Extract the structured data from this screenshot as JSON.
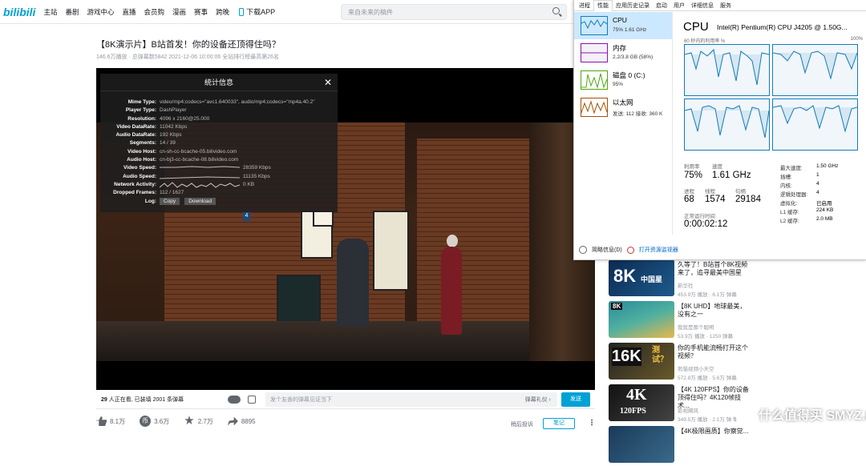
{
  "site": {
    "logo": "bilibili",
    "accent": "#00a1d6"
  },
  "nav": [
    "主站",
    "番剧",
    "游戏中心",
    "直播",
    "会员购",
    "漫画",
    "赛事",
    "跨晚"
  ],
  "download_app": "下载APP",
  "search": {
    "placeholder": "来自未来的稿件"
  },
  "video": {
    "title": "【8K演示片】B站首发！你的设备还顶得住吗？",
    "meta": "146.6万播放 · 总弹幕数5842    2021-12-06 10:00:06  全站排行榜最高第26名"
  },
  "stats": {
    "title": "统计信息",
    "close": "✕",
    "rows": [
      {
        "k": "Mime Type:",
        "v": "video/mp4;codecs=\"avc1.640033\", audio/mp4;codecs=\"mp4a.40.2\""
      },
      {
        "k": "Player Type:",
        "v": "DashPlayer"
      },
      {
        "k": "Resolution:",
        "v": "4096 x 2160@25.000"
      },
      {
        "k": "Video DataRate:",
        "v": "11042 Kbps"
      },
      {
        "k": "Audio DataRate:",
        "v": "192 Kbps"
      },
      {
        "k": "Segments:",
        "v": "14 / 39"
      },
      {
        "k": "Video Host:",
        "v": "cn-sh-cc-bcache-05.bilivideo.com"
      },
      {
        "k": "Audio Host:",
        "v": "cn-bj3-cc-bcache-08.bilivideo.com"
      },
      {
        "k": "Video Speed:",
        "v": "28359 Kbps"
      },
      {
        "k": "Audio Speed:",
        "v": "11135 Kbps"
      },
      {
        "k": "Network Activity:",
        "v": "0 KB"
      },
      {
        "k": "Dropped Frames:",
        "v": "112 / 1627"
      },
      {
        "k": "Log:",
        "v": ""
      }
    ],
    "copy": "Copy",
    "download": "Download"
  },
  "scene_sign": "4",
  "controls": {
    "watching": "29",
    "watching_suffix": " 人正在看, 已装填 2001 条弹幕",
    "danmaku_placeholder": "发个友善的弹幕见证当下",
    "etiquette": "弹幕礼仪 ›",
    "send": "发送"
  },
  "actions": {
    "like": "8.1万",
    "coin": "3.6万",
    "coin_glyph": "币",
    "fav": "2.7万",
    "share": "8895",
    "report": "稍后投诉",
    "note": "笔记",
    "more": "⋮"
  },
  "recs": [
    {
      "title": "久等了！B站首个8K视频来了，追寻最美中国星",
      "up": "新华社",
      "stats": "453.9万 播放 · 6.1万 弹幕",
      "thumb_text": "8K",
      "thumb_sub": "中国星",
      "color1": "#0b2a52",
      "color2": "#1e5a8c"
    },
    {
      "title": "【8K UHD】地球最美，没有之一",
      "up": "我就是那个聪明",
      "stats": "53.9万 播放 · 1250 弹幕",
      "thumb_text": "8K",
      "thumb_sub": "",
      "color1": "#2a8a9c",
      "color2": "#e8b84a"
    },
    {
      "title": "你的手机能流畅打开这个视频？",
      "up": "熊猫视频小天空",
      "stats": "572.8万 播放 · 5.6万 弹幕",
      "thumb_text": "16K",
      "thumb_sub": "测试？",
      "color1": "#222222",
      "color2": "#6a5a2a"
    },
    {
      "title": "【4K 120FPS】你的设备顶得住吗？4K120帧技术...",
      "up": "影视飓风",
      "stats": "349.5万 播放 · 2.1万 弹幕",
      "thumb_text": "4K",
      "thumb_sub": "120FPS",
      "color1": "#111111",
      "color2": "#444444"
    },
    {
      "title": "【4K极限画质】你察觉...",
      "up": "",
      "stats": "",
      "thumb_text": "",
      "thumb_sub": "",
      "color1": "#1a3a5a",
      "color2": "#3a6a8a"
    }
  ],
  "taskmgr": {
    "tabs": [
      "进程",
      "性能",
      "应用历史记录",
      "启动",
      "用户",
      "详细信息",
      "服务"
    ],
    "sidebar": [
      {
        "name": "CPU",
        "val": "75%  1.61 GHz",
        "color": "#117dbb"
      },
      {
        "name": "内存",
        "val": "2.2/3.8 GB (58%)",
        "color": "#8b12ae"
      },
      {
        "name": "磁盘 0 (C:)",
        "val": "95%",
        "color": "#4da60c"
      },
      {
        "name": "以太网",
        "val": "发送: 112 接收: 360 K",
        "color": "#a74f01"
      }
    ],
    "cpu_title": "CPU",
    "cpu_name": "Intel(R) Pentium(R) CPU J4205 @ 1.50G...",
    "util_label": "60 秒内的利用率 %",
    "util_max": "100%",
    "metrics": {
      "util_label": "利用率",
      "util": "75%",
      "speed_label": "速度",
      "speed": "1.61 GHz",
      "proc_label": "进程",
      "proc": "68",
      "thread_label": "线程",
      "thread": "1574",
      "handle_label": "句柄",
      "handle": "29184",
      "uptime_label": "正常运行时间",
      "uptime": "0:00:02:12"
    },
    "right_kv": [
      {
        "k": "最大速度:",
        "v": "1.50 GHz"
      },
      {
        "k": "插槽:",
        "v": "1"
      },
      {
        "k": "内核:",
        "v": "4"
      },
      {
        "k": "逻辑处理器:",
        "v": "4"
      },
      {
        "k": "虚拟化:",
        "v": "已启用"
      },
      {
        "k": "L1 缓存:",
        "v": "224 KB"
      },
      {
        "k": "L2 缓存:",
        "v": "2.0 MB"
      }
    ],
    "footer_less": "简略信息(D)",
    "footer_monitor": "打开资源监视器"
  },
  "watermark": "什么值得买 SMYZ.NET"
}
